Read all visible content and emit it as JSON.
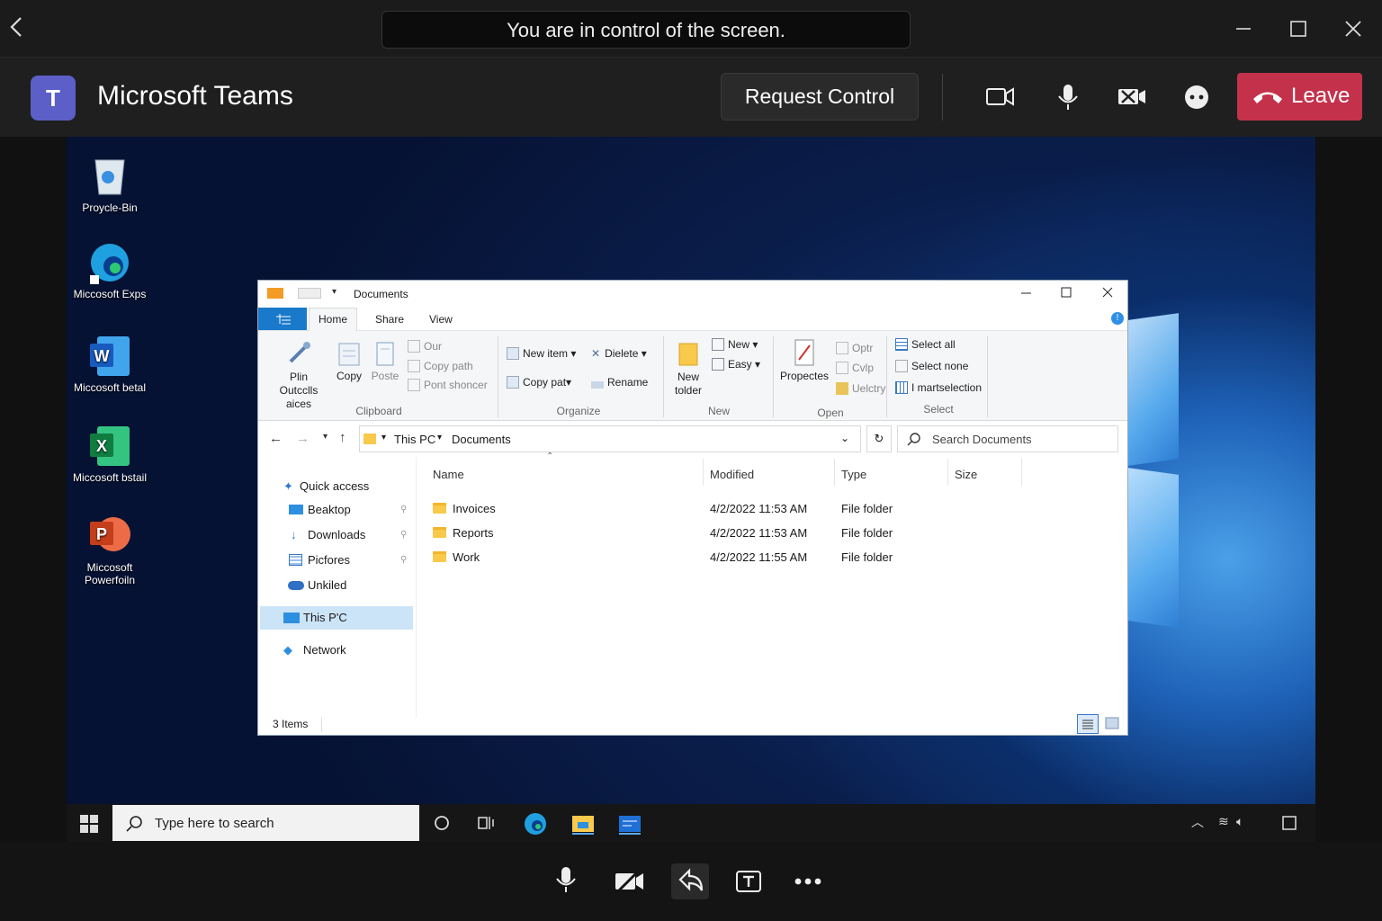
{
  "banner": {
    "text": "You are in control of the screen."
  },
  "teams": {
    "logo_letter": "T",
    "title": "Microsoft Teams",
    "request_control": "Request Control",
    "leave": "Leave"
  },
  "desktop": {
    "icons": [
      {
        "label": "Proycle-Bin"
      },
      {
        "label": "Miccosoft Exps"
      },
      {
        "label": "Miccosoft betal"
      },
      {
        "label": "Miccosoft bstail"
      },
      {
        "label": "Miccosoft Powerfoiln"
      }
    ],
    "icon_letters": {
      "word": "W",
      "excel": "X",
      "powerpoint": "P"
    }
  },
  "explorer": {
    "title": "Documents",
    "tabs": {
      "file": "File",
      "home": "Home",
      "share": "Share",
      "view": "View"
    },
    "ribbon": {
      "clipboard": {
        "pin": "Plin Outcclls aices",
        "copy": "Copy",
        "paste": "Poste",
        "cut": "Our",
        "copy_path": "Copy path",
        "paste_shortcut": "Pont shoncer",
        "group": "Clipboard"
      },
      "organize": {
        "new_item": "New item",
        "copy_to": "Copy pat",
        "delete": "Dielete",
        "rename": "Rename",
        "group": "Organize"
      },
      "new": {
        "new_folder": "New tolder",
        "new": "New",
        "easy": "Easy",
        "group": "New"
      },
      "open": {
        "properties": "Propectes",
        "open": "Optr",
        "edit": "Cvlp",
        "history": "Uelctry",
        "group": "Open"
      },
      "select": {
        "all": "Select all",
        "none": "Select none",
        "invert": "I martselection",
        "group": "Select"
      }
    },
    "breadcrumb": {
      "root": "This PC",
      "current": "Documents"
    },
    "search_placeholder": "Search Documents",
    "nav": {
      "quick_access": "Quick access",
      "desktop": "Beaktop",
      "downloads": "Downloads",
      "pictures": "Picfores",
      "onedrive": "Unkiled",
      "this_pc": "This P'C",
      "network": "Network"
    },
    "columns": {
      "name": "Name",
      "modified": "Modified",
      "type": "Type",
      "size": "Size"
    },
    "rows": [
      {
        "name": "Invoices",
        "modified": "4/2/2022 11:53 AM",
        "type": "File folder"
      },
      {
        "name": "Reports",
        "modified": "4/2/2022 11:53 AM",
        "type": "File folder"
      },
      {
        "name": "Work",
        "modified": "4/2/2022 11:55 AM",
        "type": "File folder"
      }
    ],
    "status": "3 Items"
  },
  "taskbar": {
    "search_placeholder": "Type here to search"
  },
  "colors": {
    "teams_purple": "#5b5fc7",
    "leave_red": "#c4314b",
    "selection": "#cce4f7",
    "folder": "#f8c94b"
  }
}
